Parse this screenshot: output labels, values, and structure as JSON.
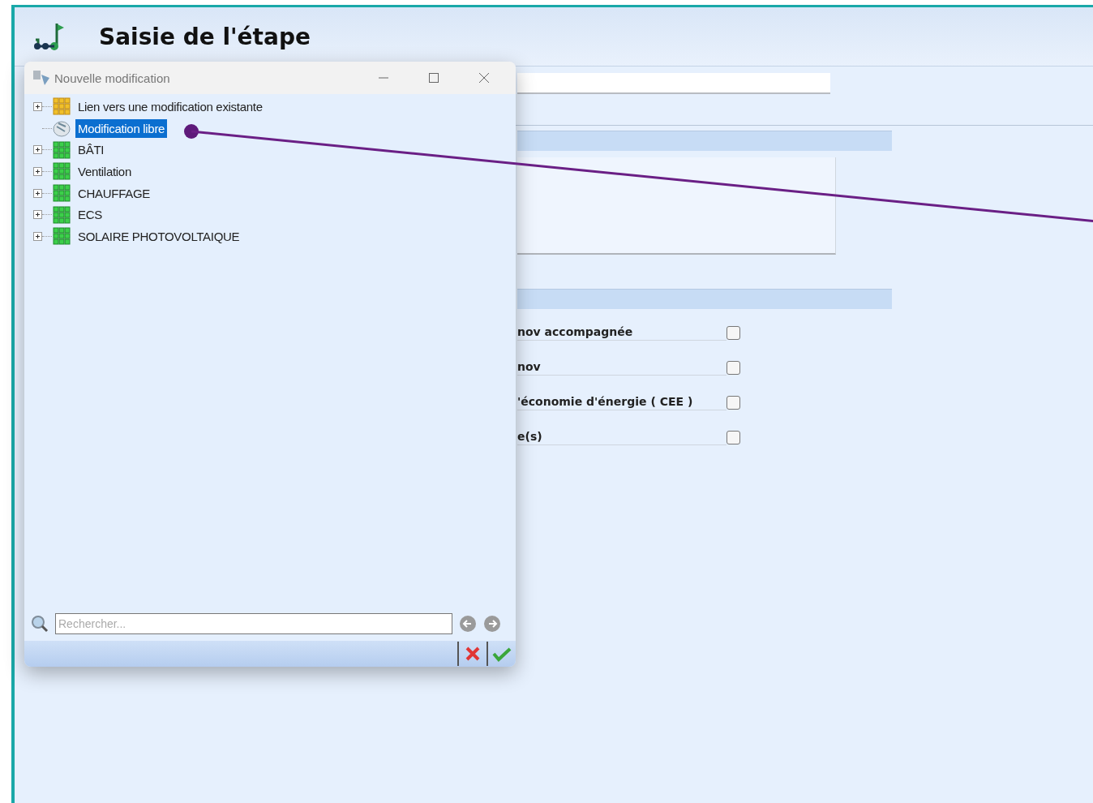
{
  "window": {
    "title": "Saisie de l'étape"
  },
  "form": {
    "sections": [
      {
        "kind": "textarea"
      },
      {
        "kind": "checkboxes"
      }
    ],
    "options": [
      {
        "label": "nov accompagnée",
        "checked": false
      },
      {
        "label": "nov",
        "checked": false
      },
      {
        "label": "'économie d'énergie ( CEE )",
        "checked": false
      },
      {
        "label": "e(s)",
        "checked": false
      }
    ]
  },
  "dialog": {
    "title": "Nouvelle modification",
    "tree": [
      {
        "label": "Lien vers une modification existante",
        "kind": "link",
        "expandable": true,
        "selected": false
      },
      {
        "label": "Modification libre",
        "kind": "free",
        "expandable": false,
        "selected": true
      },
      {
        "label": "BÂTI",
        "kind": "group",
        "expandable": true,
        "selected": false
      },
      {
        "label": "Ventilation",
        "kind": "group",
        "expandable": true,
        "selected": false
      },
      {
        "label": "CHAUFFAGE",
        "kind": "group",
        "expandable": true,
        "selected": false
      },
      {
        "label": "ECS",
        "kind": "group",
        "expandable": true,
        "selected": false
      },
      {
        "label": "SOLAIRE PHOTOVOLTAIQUE",
        "kind": "group",
        "expandable": true,
        "selected": false
      }
    ],
    "search": {
      "placeholder": "Rechercher..."
    }
  }
}
